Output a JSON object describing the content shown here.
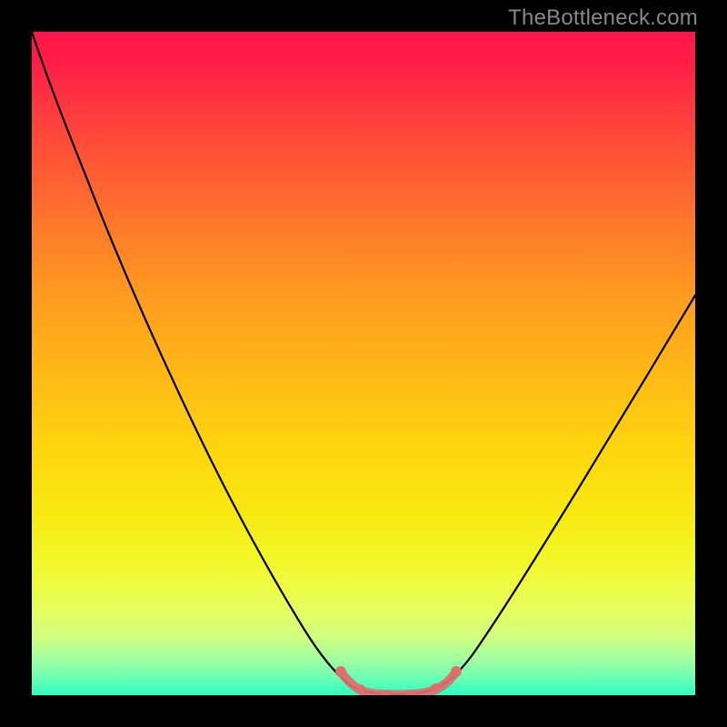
{
  "watermark": "TheBottleneck.com",
  "chart_data": {
    "type": "line",
    "title": "",
    "xlabel": "",
    "ylabel": "",
    "xlim": [
      0,
      100
    ],
    "ylim": [
      0,
      100
    ],
    "categories": [],
    "series": [
      {
        "name": "curve",
        "color": "#000000",
        "x": [
          0,
          5,
          10,
          15,
          20,
          25,
          30,
          35,
          40,
          45,
          47,
          49,
          51,
          53,
          55,
          57,
          59,
          61,
          63,
          70,
          80,
          90,
          100
        ],
        "values": [
          100,
          93,
          84,
          75,
          66,
          56,
          47,
          38,
          28,
          17,
          12,
          7,
          3,
          1,
          0,
          0,
          0,
          1,
          3,
          12,
          28,
          45,
          62
        ]
      },
      {
        "name": "highlight",
        "color": "#dd6f6f",
        "x": [
          47,
          49,
          51,
          53,
          55,
          57,
          59,
          61,
          63
        ],
        "values": [
          12,
          7,
          3,
          1,
          0,
          0,
          0,
          1,
          3
        ]
      }
    ],
    "background_gradient": {
      "direction": "top-to-bottom",
      "stops": [
        {
          "at": 0,
          "color": "#ff1749"
        },
        {
          "at": 25,
          "color": "#ff6a2f"
        },
        {
          "at": 50,
          "color": "#ffb517"
        },
        {
          "at": 75,
          "color": "#f3f423"
        },
        {
          "at": 100,
          "color": "#2bffc0"
        }
      ]
    }
  }
}
